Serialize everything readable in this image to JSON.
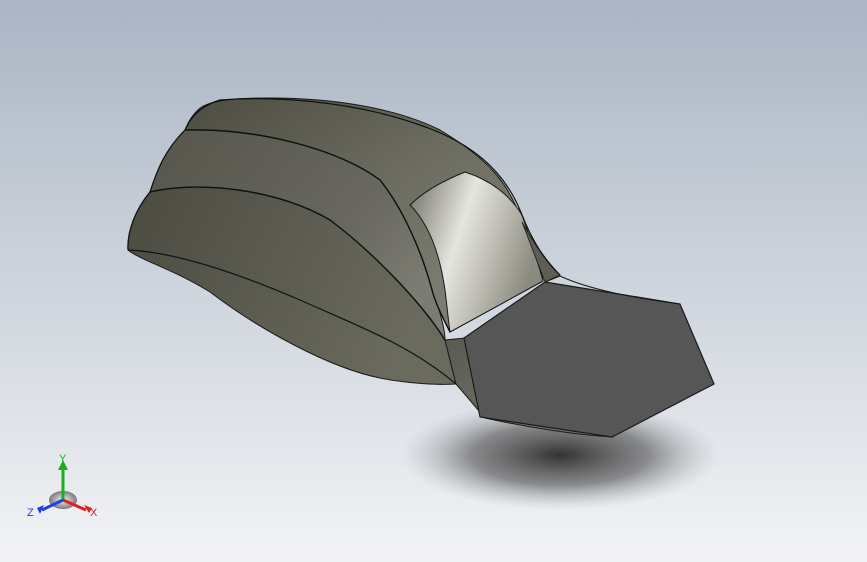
{
  "viewport": {
    "background_top": "#aab5c4",
    "background_bottom": "#f2f3f5",
    "model": {
      "name": "lofted-solid",
      "body_color": "#6a6a5e",
      "highlight_color": "#e6e6e0",
      "end_face_color": "#565656",
      "edge_color": "#1a1a1a"
    },
    "triad": {
      "x_label": "X",
      "y_label": "Y",
      "z_label": "Z",
      "x_color": "#e02020",
      "y_color": "#18b020",
      "z_color": "#2040e0"
    }
  }
}
